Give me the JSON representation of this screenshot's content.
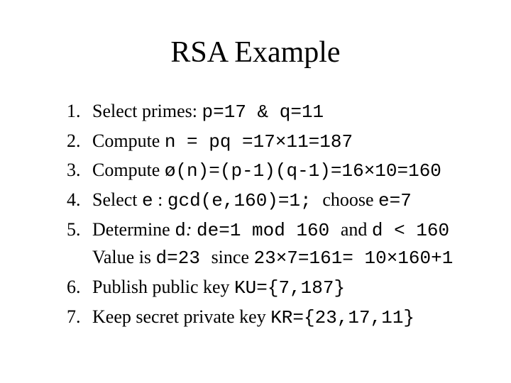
{
  "title": "RSA Example",
  "steps": {
    "s1_text": "Select primes: ",
    "s1_code": "p=17 & q=11",
    "s2_text": "Compute ",
    "s2_code": "n = pq =17×11=187",
    "s3_text": "Compute ",
    "s3_code": "ø(n)=(p-1)(q-1)=16×10=160",
    "s4_text_a": "Select ",
    "s4_code_a": "e",
    "s4_text_b": " : ",
    "s4_code_b": "gcd(e,160)=1; ",
    "s4_text_c": "choose ",
    "s4_code_c": "e=7",
    "s5_text_a": "Determine ",
    "s5_code_a": "d",
    "s5_italic_a": ": ",
    "s5_code_b": "de=1 mod 160 ",
    "s5_text_b": "and ",
    "s5_code_c": "d < 160",
    "s5_line2_a": "Value is ",
    "s5_line2_code_a": "d=23 ",
    "s5_line2_b": "since ",
    "s5_line2_code_b": "23×7=161= 10×160+1",
    "s6_text": "Publish public key ",
    "s6_code": "KU={7,187}",
    "s7_text": "Keep secret private key ",
    "s7_code": "KR={23,17,11}"
  }
}
